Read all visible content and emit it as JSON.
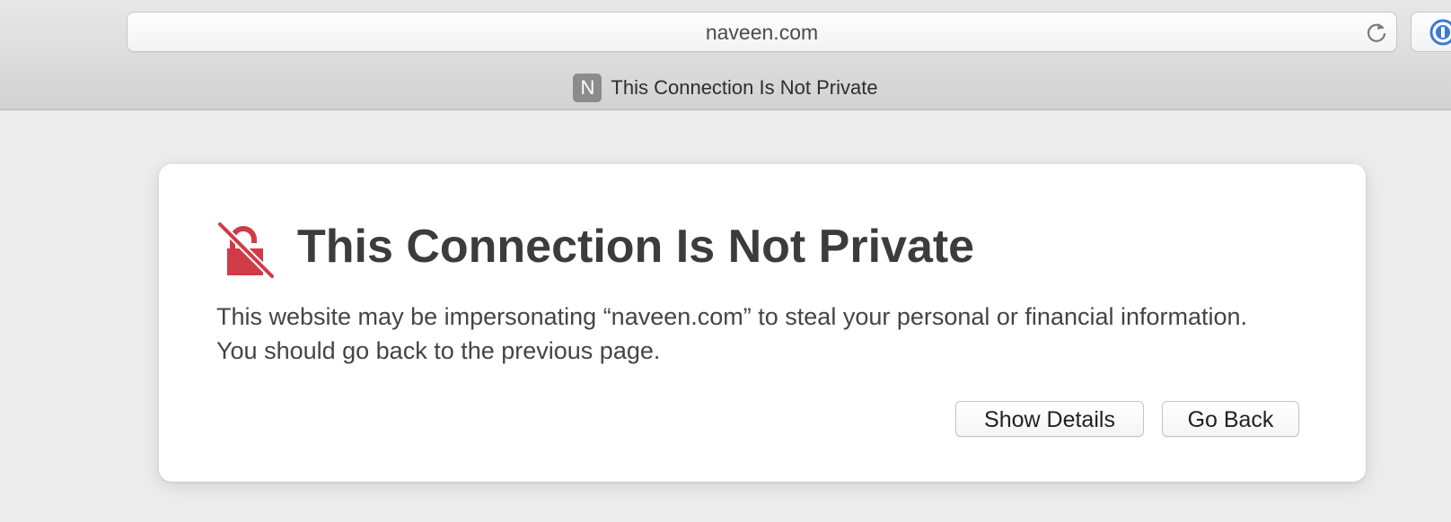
{
  "browser": {
    "address_bar": {
      "url": "naveen.com",
      "reload_icon": "reload-icon"
    },
    "extension_icon": "onepassword-icon",
    "tab": {
      "favicon_letter": "N",
      "title": "This Connection Is Not Private"
    }
  },
  "warning": {
    "icon": "broken-lock-icon",
    "icon_color": "#d13a47",
    "heading": "This Connection Is Not Private",
    "message": "This website may be impersonating “naveen.com” to steal your personal or financial information. You should go back to the previous page.",
    "buttons": {
      "show_details": "Show Details",
      "go_back": "Go Back"
    }
  }
}
